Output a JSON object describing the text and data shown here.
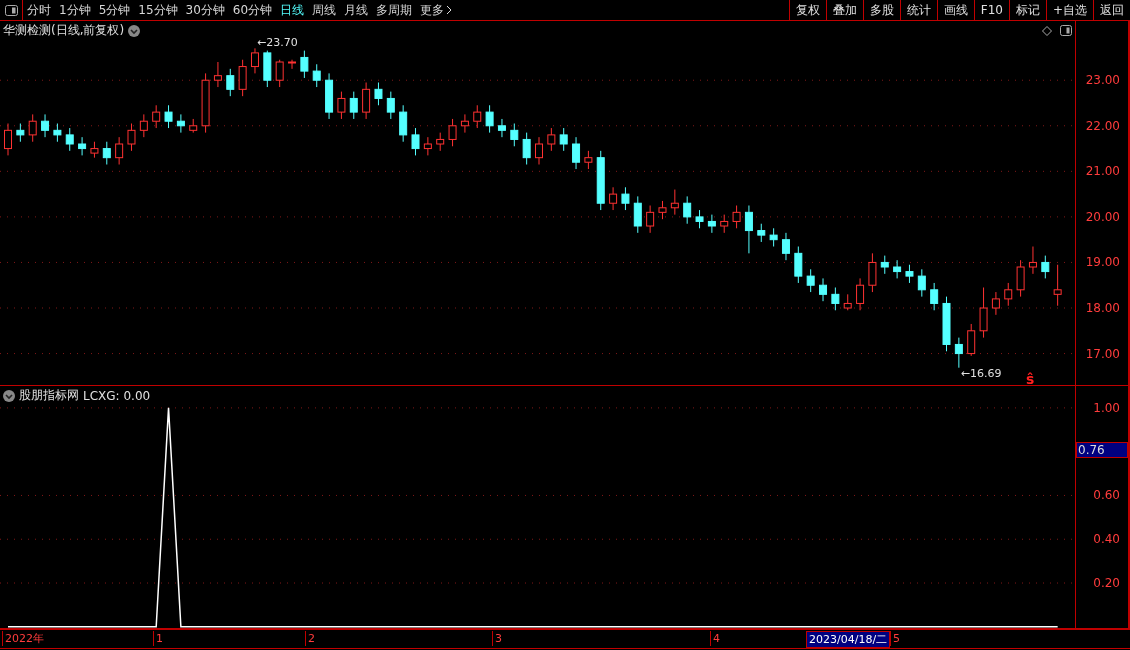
{
  "toolbar": {
    "periods": [
      {
        "label": "分时",
        "selected": false
      },
      {
        "label": "1分钟",
        "selected": false
      },
      {
        "label": "5分钟",
        "selected": false
      },
      {
        "label": "15分钟",
        "selected": false
      },
      {
        "label": "30分钟",
        "selected": false
      },
      {
        "label": "60分钟",
        "selected": false
      },
      {
        "label": "日线",
        "selected": true
      },
      {
        "label": "周线",
        "selected": false
      },
      {
        "label": "月线",
        "selected": false
      },
      {
        "label": "多周期",
        "selected": false
      }
    ],
    "more": "更多",
    "actions": [
      "复权",
      "叠加",
      "多股",
      "统计",
      "画线",
      "F10",
      "标记",
      "+自选",
      "返回"
    ]
  },
  "chart": {
    "title": "华测检测(日线,前复权)",
    "high_label": "←23.70",
    "low_label": "←16.69",
    "signal_mark": "ŝ",
    "chart_data": {
      "type": "candlestick",
      "grid": true,
      "ylim": [
        16.31,
        24.3
      ],
      "yticks": [
        {
          "value": 23,
          "label": "23.00"
        },
        {
          "value": 22,
          "label": "22.00"
        },
        {
          "value": 21,
          "label": "21.00"
        },
        {
          "value": 20,
          "label": "20.00"
        },
        {
          "value": 19,
          "label": "19.00"
        },
        {
          "value": 18,
          "label": "18.00"
        },
        {
          "value": 17,
          "label": "17.00"
        }
      ],
      "ohlc": [
        [
          21.5,
          22.05,
          21.35,
          21.9
        ],
        [
          21.9,
          22.05,
          21.65,
          21.8
        ],
        [
          21.8,
          22.25,
          21.65,
          22.1
        ],
        [
          22.1,
          22.25,
          21.75,
          21.9
        ],
        [
          21.9,
          22.05,
          21.65,
          21.8
        ],
        [
          21.8,
          21.95,
          21.45,
          21.6
        ],
        [
          21.6,
          21.75,
          21.35,
          21.5
        ],
        [
          21.4,
          21.65,
          21.3,
          21.5
        ],
        [
          21.5,
          21.65,
          21.15,
          21.3
        ],
        [
          21.3,
          21.75,
          21.15,
          21.6
        ],
        [
          21.6,
          22.05,
          21.45,
          21.9
        ],
        [
          21.9,
          22.25,
          21.75,
          22.1
        ],
        [
          22.1,
          22.45,
          21.95,
          22.3
        ],
        [
          22.3,
          22.45,
          21.95,
          22.1
        ],
        [
          22.1,
          22.25,
          21.85,
          22.0
        ],
        [
          21.9,
          22.15,
          21.85,
          22.0
        ],
        [
          22.0,
          23.15,
          21.85,
          23.0
        ],
        [
          23.0,
          23.4,
          22.85,
          23.1
        ],
        [
          23.1,
          23.25,
          22.65,
          22.8
        ],
        [
          22.8,
          23.45,
          22.65,
          23.3
        ],
        [
          23.3,
          23.7,
          23.15,
          23.6
        ],
        [
          23.6,
          23.65,
          22.85,
          23.0
        ],
        [
          23.0,
          23.45,
          22.85,
          23.4
        ],
        [
          23.4,
          23.45,
          23.25,
          23.4
        ],
        [
          23.5,
          23.65,
          23.05,
          23.2
        ],
        [
          23.2,
          23.35,
          22.85,
          23.0
        ],
        [
          23.0,
          23.15,
          22.15,
          22.3
        ],
        [
          22.3,
          22.75,
          22.15,
          22.6
        ],
        [
          22.6,
          22.75,
          22.15,
          22.3
        ],
        [
          22.3,
          22.95,
          22.15,
          22.8
        ],
        [
          22.8,
          22.95,
          22.45,
          22.6
        ],
        [
          22.6,
          22.75,
          22.15,
          22.3
        ],
        [
          22.3,
          22.45,
          21.65,
          21.8
        ],
        [
          21.8,
          21.95,
          21.35,
          21.5
        ],
        [
          21.5,
          21.75,
          21.35,
          21.6
        ],
        [
          21.6,
          21.85,
          21.45,
          21.7
        ],
        [
          21.7,
          22.15,
          21.55,
          22.0
        ],
        [
          22.0,
          22.25,
          21.85,
          22.1
        ],
        [
          22.1,
          22.45,
          21.95,
          22.3
        ],
        [
          22.3,
          22.45,
          21.85,
          22.0
        ],
        [
          22.0,
          22.15,
          21.75,
          21.9
        ],
        [
          21.9,
          22.05,
          21.55,
          21.7
        ],
        [
          21.7,
          21.85,
          21.15,
          21.3
        ],
        [
          21.3,
          21.75,
          21.15,
          21.6
        ],
        [
          21.6,
          21.95,
          21.45,
          21.8
        ],
        [
          21.8,
          21.95,
          21.45,
          21.6
        ],
        [
          21.6,
          21.75,
          21.05,
          21.2
        ],
        [
          21.2,
          21.45,
          21.05,
          21.3
        ],
        [
          21.3,
          21.45,
          20.15,
          20.3
        ],
        [
          20.3,
          20.65,
          20.15,
          20.5
        ],
        [
          20.5,
          20.65,
          20.15,
          20.3
        ],
        [
          20.3,
          20.45,
          19.65,
          19.8
        ],
        [
          19.8,
          20.25,
          19.65,
          20.1
        ],
        [
          20.1,
          20.35,
          19.95,
          20.2
        ],
        [
          20.2,
          20.6,
          20.05,
          20.3
        ],
        [
          20.3,
          20.45,
          19.85,
          20.0
        ],
        [
          20.0,
          20.15,
          19.75,
          19.9
        ],
        [
          19.9,
          20.05,
          19.65,
          19.8
        ],
        [
          19.8,
          20.05,
          19.65,
          19.9
        ],
        [
          19.9,
          20.25,
          19.75,
          20.1
        ],
        [
          20.1,
          20.25,
          19.2,
          19.7
        ],
        [
          19.7,
          19.85,
          19.45,
          19.6
        ],
        [
          19.6,
          19.75,
          19.35,
          19.5
        ],
        [
          19.5,
          19.65,
          19.05,
          19.2
        ],
        [
          19.2,
          19.35,
          18.55,
          18.7
        ],
        [
          18.7,
          18.85,
          18.35,
          18.5
        ],
        [
          18.5,
          18.65,
          18.15,
          18.3
        ],
        [
          18.3,
          18.45,
          17.95,
          18.1
        ],
        [
          18.0,
          18.3,
          17.95,
          18.1
        ],
        [
          18.1,
          18.65,
          17.95,
          18.5
        ],
        [
          18.5,
          19.2,
          18.35,
          19.0
        ],
        [
          19.0,
          19.15,
          18.75,
          18.9
        ],
        [
          18.9,
          19.05,
          18.65,
          18.8
        ],
        [
          18.8,
          18.95,
          18.55,
          18.7
        ],
        [
          18.7,
          18.85,
          18.25,
          18.4
        ],
        [
          18.4,
          18.55,
          17.95,
          18.1
        ],
        [
          18.1,
          18.25,
          17.05,
          17.2
        ],
        [
          17.2,
          17.35,
          16.69,
          17.0
        ],
        [
          17.0,
          17.65,
          16.95,
          17.5
        ],
        [
          17.5,
          18.45,
          17.35,
          18.0
        ],
        [
          18.0,
          18.35,
          17.85,
          18.2
        ],
        [
          18.2,
          18.55,
          18.05,
          18.4
        ],
        [
          18.4,
          19.05,
          18.25,
          18.9
        ],
        [
          18.9,
          19.35,
          18.75,
          19.0
        ],
        [
          19.0,
          19.15,
          18.65,
          18.8
        ],
        [
          18.3,
          18.95,
          18.05,
          18.4
        ]
      ]
    }
  },
  "indicator": {
    "name": "股朋指标网",
    "reading": "LCXG: 0.00",
    "cursor_value": "0.76",
    "chart_data": {
      "type": "line",
      "grid": true,
      "ylim": [
        -0.01,
        1.1
      ],
      "yticks": [
        {
          "value": 1,
          "label": "1.00"
        },
        {
          "value": 0.6,
          "label": "0.60"
        },
        {
          "value": 0.4,
          "label": "0.40"
        },
        {
          "value": 0.2,
          "label": "0.20"
        }
      ],
      "series": [
        {
          "color": "#ffffff",
          "values": [
            0,
            0,
            0,
            0,
            0,
            0,
            0,
            0,
            0,
            0,
            0,
            0,
            0,
            1,
            0,
            0,
            0,
            0,
            0,
            0,
            0,
            0,
            0,
            0,
            0,
            0,
            0,
            0,
            0,
            0,
            0,
            0,
            0,
            0,
            0,
            0,
            0,
            0,
            0,
            0,
            0,
            0,
            0,
            0,
            0,
            0,
            0,
            0,
            0,
            0,
            0,
            0,
            0,
            0,
            0,
            0,
            0,
            0,
            0,
            0,
            0,
            0,
            0,
            0,
            0,
            0,
            0,
            0,
            0,
            0,
            0,
            0,
            0,
            0,
            0,
            0,
            0,
            0,
            0,
            0,
            0,
            0,
            0,
            0,
            0,
            0
          ]
        }
      ]
    }
  },
  "date_axis": {
    "labels": [
      {
        "text": "2022年",
        "selected": false
      },
      {
        "text": "1",
        "selected": false
      },
      {
        "text": "2",
        "selected": false
      },
      {
        "text": "3",
        "selected": false
      },
      {
        "text": "4",
        "selected": false
      },
      {
        "text": "2023/04/18/二",
        "selected": true
      },
      {
        "text": "5",
        "selected": false
      }
    ]
  }
}
